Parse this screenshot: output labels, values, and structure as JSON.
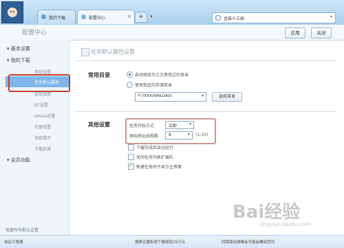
{
  "titlebar": {
    "tabs": [
      {
        "label": "我的下载",
        "active": false
      },
      {
        "label": "配置中心",
        "active": true
      }
    ],
    "new_tab": "+",
    "search_text": "金装十三妹"
  },
  "header": {
    "title": "配置中心",
    "apply_label": "应用",
    "close_label": "关闭"
  },
  "sidebar": {
    "sections": [
      "基本设置",
      "我的下载",
      "会员功能"
    ],
    "items": [
      "常规设置",
      "任务默认属性",
      "监视设置",
      "BT设置",
      "eMule设置",
      "代理设置",
      "消息提示",
      "下载加速"
    ],
    "selected": "任务默认属性",
    "footer": "恢复所有默认设置"
  },
  "main": {
    "section_title": "任务默认属性设置",
    "common_dir": {
      "label": "常用目录",
      "option1": "自动修改为上次使用过的目录",
      "option2": "使用指定的存储目录",
      "path": "F:\\TDDOWNLOAD\\",
      "choose_button": "选择目录"
    },
    "other": {
      "label": "其他设置",
      "start_mode_label": "任务开始方式",
      "start_mode_value": "立即",
      "threads_label": "原始地址线程数",
      "threads_value": "8",
      "threads_range": "(1-10)",
      "check1": "下载完成后自动运行",
      "check2": "关闭任务列表扩展栏",
      "check3": "新建任务时不显示主界面"
    }
  },
  "statusbar": {
    "left": "自定义限速",
    "center": "搜索迅雷影视下载频道25万元",
    "right": "同镜演出席峰会可能会嘲讽芭吗"
  },
  "watermark": {
    "brand": "Bai经验",
    "url": "jingyan.baidu.com"
  }
}
